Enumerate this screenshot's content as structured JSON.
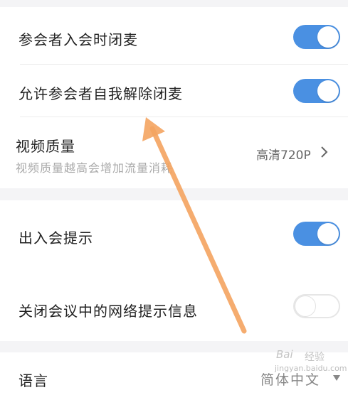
{
  "settings": {
    "mute_on_join": {
      "label": "参会者入会时闭麦",
      "enabled": true
    },
    "allow_self_unmute": {
      "label": "允许参会者自我解除闭麦",
      "enabled": true
    },
    "video_quality": {
      "label": "视频质量",
      "description": "视频质量越高会增加流量消耗",
      "value": "高清720P"
    },
    "join_leave_prompt": {
      "label": "出入会提示",
      "enabled": true
    },
    "disable_network_tips": {
      "label": "关闭会议中的网络提示信息",
      "enabled": false
    },
    "language": {
      "label": "语言",
      "value": "简体中文"
    }
  },
  "watermark": {
    "line1": "Bai",
    "line2": "经验",
    "line3": "jingyan.baidu.com"
  },
  "colors": {
    "toggle_on": "#4a90e2",
    "arrow": "#f4a460",
    "background": "#f4f4f6"
  },
  "icons": {
    "chevron": "chevron-right-icon",
    "dropdown": "triangle-down-icon",
    "annotation": "arrow-annotation"
  }
}
